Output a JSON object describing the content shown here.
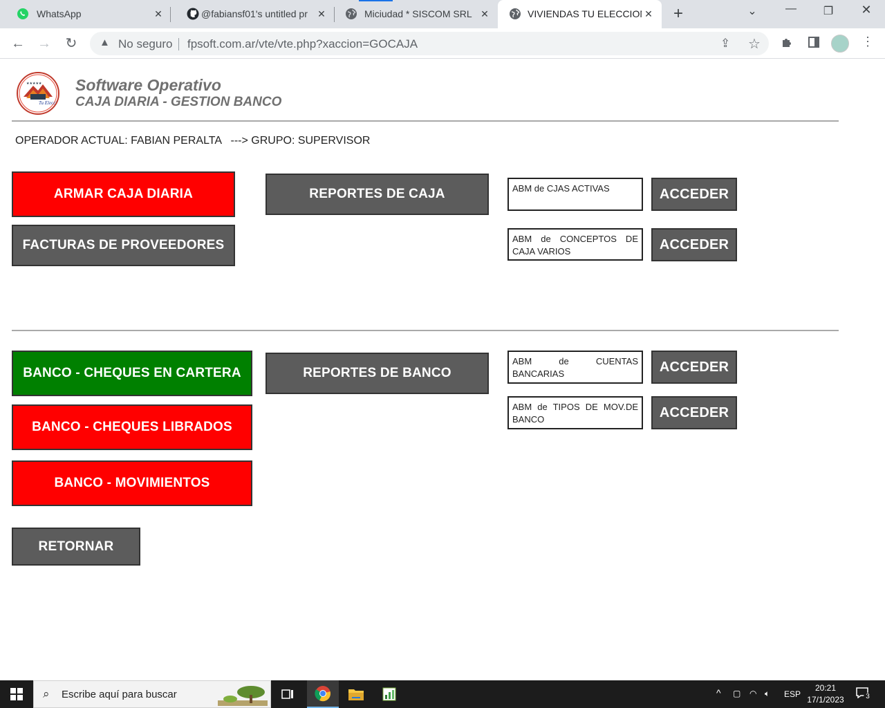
{
  "browser": {
    "tabs": [
      {
        "label": "WhatsApp",
        "icon": "whatsapp-icon"
      },
      {
        "label": "@fabiansf01's untitled pr",
        "icon": "github-icon"
      },
      {
        "label": "Miciudad * SISCOM SRL",
        "icon": "globe-icon"
      },
      {
        "label": "VIVIENDAS TU ELECCION",
        "icon": "globe-icon",
        "active": true
      }
    ],
    "security_label": "No seguro",
    "url": "fpsoft.com.ar/vte/vte.php?xaccion=GOCAJA"
  },
  "header": {
    "title": "Software Operativo",
    "subtitle": "CAJA DIARIA - GESTION BANCO"
  },
  "operator_line": "OPERADOR ACTUAL: FABIAN PERALTA   ---> GRUPO: SUPERVISOR",
  "caja_section": {
    "armar_caja": "ARMAR CAJA DIARIA",
    "facturas": "FACTURAS DE PROVEEDORES",
    "reportes_caja": "REPORTES DE CAJA",
    "abm_items": [
      {
        "label": "ABM de CJAS ACTIVAS",
        "button": "ACCEDER"
      },
      {
        "label": "ABM de CONCEPTOS DE CAJA VARIOS",
        "button": "ACCEDER"
      }
    ]
  },
  "banco_section": {
    "cheques_cartera": "BANCO - CHEQUES EN CARTERA",
    "cheques_librados": "BANCO - CHEQUES LIBRADOS",
    "movimientos": "BANCO - MOVIMIENTOS",
    "reportes_banco": "REPORTES DE BANCO",
    "abm_items": [
      {
        "label": "ABM de CUENTAS BANCARIAS",
        "button": "ACCEDER"
      },
      {
        "label": "ABM de TIPOS DE MOV.DE BANCO",
        "button": "ACCEDER"
      }
    ]
  },
  "retornar": "RETORNAR",
  "taskbar": {
    "search_placeholder": "Escribe aquí para buscar",
    "language": "ESP",
    "time": "20:21",
    "date": "17/1/2023",
    "notification_count": "3"
  },
  "colors": {
    "red": "#ff0000",
    "gray": "#5c5c5c",
    "green": "#008000"
  }
}
